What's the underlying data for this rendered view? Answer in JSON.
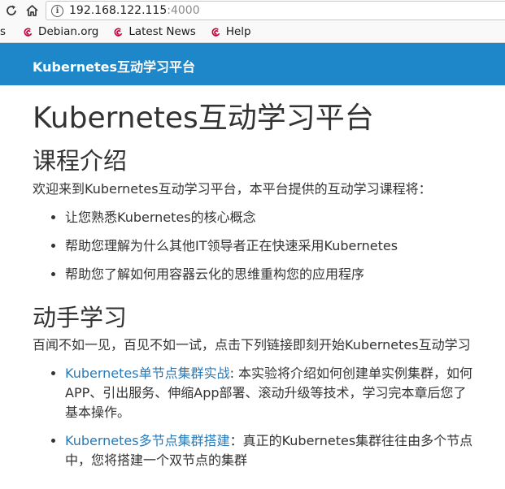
{
  "browser": {
    "url_host": "192.168.122.115",
    "url_port": ":4000",
    "bookmarks_partial": "s",
    "bookmarks": [
      {
        "label": "Debian.org"
      },
      {
        "label": "Latest News"
      },
      {
        "label": "Help"
      }
    ]
  },
  "header": {
    "site_title": "Kubernetes互动学习平台"
  },
  "main": {
    "title": "Kubernetes互动学习平台",
    "intro_heading": "课程介绍",
    "intro_text": "欢迎来到Kubernetes互动学习平台，本平台提供的互动学习课程将：",
    "intro_items": [
      "让您熟悉Kubernetes的核心概念",
      "帮助您理解为什么其他IT领导者正在快速采用Kubernetes",
      "帮助您了解如何用容器云化的思维重构您的应用程序"
    ],
    "handson_heading": "动手学习",
    "handson_text": "百闻不如一见，百见不如一试，点击下列链接即刻开始Kubernetes互动学习",
    "labs": [
      {
        "link": "Kubernetes单节点集群实战",
        "desc_line1": ": 本实验将介绍如何创建单实例集群，如何",
        "desc_line2": "APP、引出服务、伸缩App部署、滚动升级等技术，学习完本章后您了",
        "desc_line3": "基本操作。"
      },
      {
        "link": "Kubernetes多节点集群搭建",
        "desc_line1": "：真正的Kubernetes集群往往由多个节点",
        "desc_line2": "中，您将搭建一个双节点的集群"
      }
    ]
  },
  "colors": {
    "header_bg": "#1e87c9",
    "link": "#2a7ab8",
    "text": "#333333"
  }
}
